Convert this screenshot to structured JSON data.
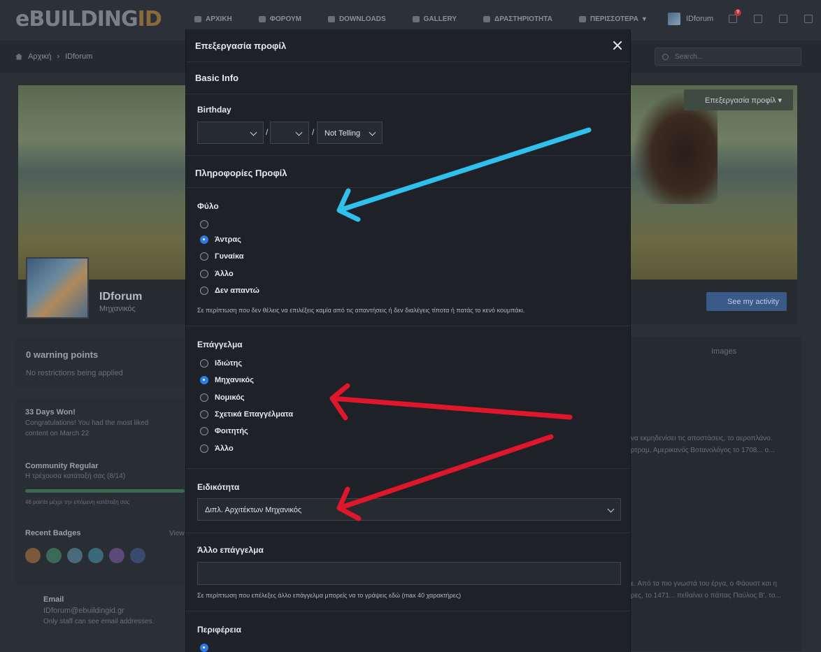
{
  "site": {
    "logo_prefix": "eBUILDING",
    "logo_suffix": "ID",
    "nav": [
      "ΑΡΧΙΚΗ",
      "ΦΟΡΟΥΜ",
      "DOWNLOADS",
      "GALLERY",
      "ΔΡΑΣΤΗΡΙΟΤΗΤΑ",
      "ΠΕΡΙΣΣΟΤΕΡΑ"
    ],
    "username": "IDforum",
    "notification_count": "9",
    "breadcrumb": [
      "Αρχική",
      "IDforum"
    ],
    "search_placeholder": "Search..."
  },
  "profile": {
    "edit_button": "Επεξεργασία προφίλ",
    "name": "IDforum",
    "role": "Μηχανικός",
    "activity_button": "See my activity",
    "images_tab": "Images",
    "warnings_title": "0 warning points",
    "warnings_sub": "No restrictions being applied",
    "won_title": "33 Days Won!",
    "won_sub": "Congratulations! You had the most liked content on March 22",
    "rank_title": "Community Regular",
    "rank_sub": "Η τρέχουσα κατάταξή σας (8/14)",
    "rank_progress": "46 points μέχρι την επόμενη κατάταξη σας",
    "badges_title": "Recent Badges",
    "badges_view": "View",
    "email_label": "Email",
    "email_value": "IDforum@ebuildingid.gr",
    "email_note": "Only staff can see email addresses.",
    "right_snippets": [
      "να εκμηδενίσει τις αποστάσεις, το αεροπλάνο.",
      "ρτραμ, Αμερικανός Βοτανολόγος το 1708... ο...",
      "ε. Από τα πιο γνωστά του έργα, ο Φάουστ και η",
      "ρες, το 1471... πεθαίνει ο πάπας Παύλος Β'. το..."
    ]
  },
  "modal": {
    "title": "Επεξεργασία προφίλ",
    "basic_info": "Basic Info",
    "birthday_label": "Birthday",
    "birthday_day": "",
    "birthday_month": "",
    "birthday_year": "Not Telling",
    "profile_info": "Πληροφορίες Προφίλ",
    "gender": {
      "label": "Φύλο",
      "options": [
        "",
        "Άντρας",
        "Γυναίκα",
        "Άλλο",
        "Δεν απαντώ"
      ],
      "selected": 1,
      "hint": "Σε περίπτωση που δεν θέλεις να επιλέξεις καμία από τις απαντήσεις ή δεν διαλέγεις τίποτα ή πατάς το κενό κουμπάκι."
    },
    "profession": {
      "label": "Επάγγελμα",
      "options": [
        "Ιδιώτης",
        "Μηχανικός",
        "Νομικός",
        "Σχετικά Επαγγέλματα",
        "Φοιτητής",
        "Άλλο"
      ],
      "selected": 1
    },
    "specialty": {
      "label": "Ειδικότητα",
      "value": "Διπλ. Αρχιτέκτων Μηχανικός"
    },
    "other_profession": {
      "label": "Άλλο επάγγελμα",
      "value": "",
      "hint": "Σε περίπτωση που επέλεξες άλλο επάγγελμα μπορείς να το γράψεις εδώ (max 40 χαρακτήρες)"
    },
    "region": {
      "label": "Περιφέρεια"
    }
  },
  "annotations": {
    "colors": {
      "blue": "#2fc0ee",
      "red": "#e0162a"
    }
  }
}
